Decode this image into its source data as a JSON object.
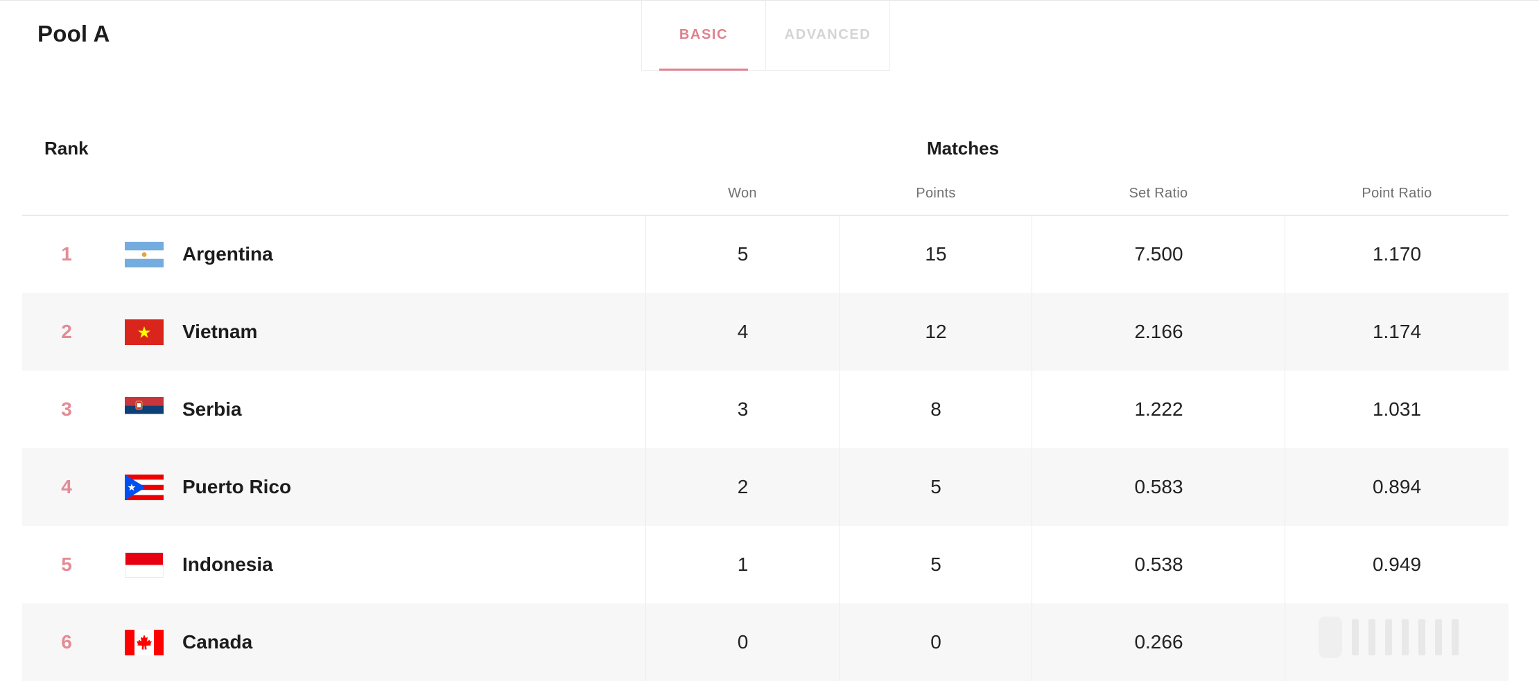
{
  "pool": {
    "title": "Pool A"
  },
  "tabs": {
    "basic": "BASIC",
    "advanced": "ADVANCED"
  },
  "table": {
    "rank_header": "Rank",
    "group_header": "Matches",
    "columns": [
      "Won",
      "Points",
      "Set Ratio",
      "Point Ratio"
    ],
    "rows": [
      {
        "rank": "1",
        "team": "Argentina",
        "flag": "argentina-flag-icon",
        "won": "5",
        "points": "15",
        "set_ratio": "7.500",
        "point_ratio": "1.170"
      },
      {
        "rank": "2",
        "team": "Vietnam",
        "flag": "vietnam-flag-icon",
        "won": "4",
        "points": "12",
        "set_ratio": "2.166",
        "point_ratio": "1.174"
      },
      {
        "rank": "3",
        "team": "Serbia",
        "flag": "serbia-flag-icon",
        "won": "3",
        "points": "8",
        "set_ratio": "1.222",
        "point_ratio": "1.031"
      },
      {
        "rank": "4",
        "team": "Puerto Rico",
        "flag": "puerto-rico-flag-icon",
        "won": "2",
        "points": "5",
        "set_ratio": "0.583",
        "point_ratio": "0.894"
      },
      {
        "rank": "5",
        "team": "Indonesia",
        "flag": "indonesia-flag-icon",
        "won": "1",
        "points": "5",
        "set_ratio": "0.538",
        "point_ratio": "0.949"
      },
      {
        "rank": "6",
        "team": "Canada",
        "flag": "canada-flag-icon",
        "won": "0",
        "points": "0",
        "set_ratio": "0.266",
        "point_ratio": ""
      }
    ]
  },
  "colors": {
    "accent": "#e0808e",
    "rank": "#e38b96",
    "alt_row": "#f7f7f7"
  }
}
